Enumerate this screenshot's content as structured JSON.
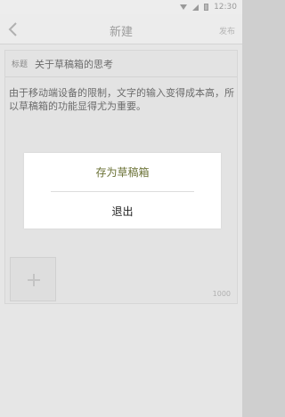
{
  "status_bar": {
    "time": "12:30"
  },
  "nav": {
    "title": "新建",
    "publish_label": "发布"
  },
  "editor": {
    "title_label": "标题",
    "title_value": "关于草稿箱的思考",
    "body": "由于移动端设备的限制，文字的输入变得成本高，所以草稿箱的功能显得尤为重要。",
    "char_count": "1000"
  },
  "dialog": {
    "save_draft_label": "存为草稿箱",
    "exit_label": "退出"
  },
  "colors": {
    "accent": "#6b7236",
    "overlay": "#e6e6e6"
  }
}
